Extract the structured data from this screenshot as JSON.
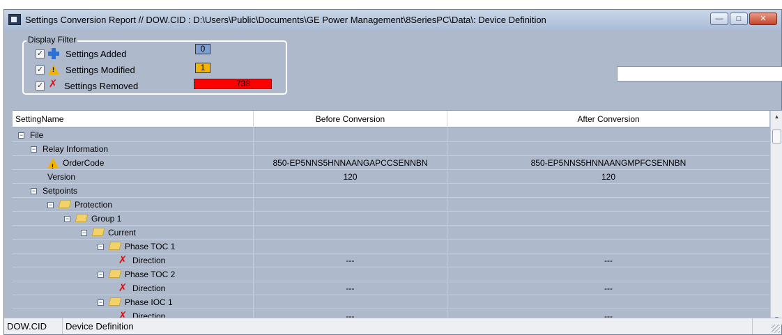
{
  "window": {
    "title": "Settings Conversion Report // DOW.CID : D:\\Users\\Public\\Documents\\GE Power Management\\8SeriesPC\\Data\\: Device Definition"
  },
  "filter": {
    "legend": "Display Filter",
    "added": {
      "label": "Settings Added",
      "count": "0",
      "checked": true,
      "color": "#7f9fd1"
    },
    "modified": {
      "label": "Settings Modified",
      "count": "1",
      "checked": true,
      "color": "#f5b400"
    },
    "removed": {
      "label": "Settings Removed",
      "count": "738",
      "checked": true,
      "color": "#ff0000"
    }
  },
  "search": {
    "value": ""
  },
  "grid": {
    "columns": [
      "SettingName",
      "Before Conversion",
      "After Conversion"
    ],
    "rows": [
      {
        "name": "File",
        "before": "",
        "after": "",
        "icon": "expander",
        "depth": 0
      },
      {
        "name": "Relay Information",
        "before": "",
        "after": "",
        "icon": "expander",
        "depth": 1
      },
      {
        "name": "OrderCode",
        "before": "850-EP5NNS5HNNAANGAPCCSENNBN",
        "after": "850-EP5NNS5HNNAANGMPFCSENNBN",
        "icon": "warning",
        "depth": 2
      },
      {
        "name": "Version",
        "before": "120",
        "after": "120",
        "icon": "none",
        "depth": 2
      },
      {
        "name": "Setpoints",
        "before": "",
        "after": "",
        "icon": "expander",
        "depth": 1
      },
      {
        "name": "Protection",
        "before": "",
        "after": "",
        "icon": "folder",
        "depth": 2
      },
      {
        "name": "Group 1",
        "before": "",
        "after": "",
        "icon": "folder",
        "depth": 3
      },
      {
        "name": "Current",
        "before": "",
        "after": "",
        "icon": "folder",
        "depth": 4
      },
      {
        "name": "Phase TOC 1",
        "before": "",
        "after": "",
        "icon": "folder",
        "depth": 5
      },
      {
        "name": "Direction",
        "before": "---",
        "after": "---",
        "icon": "removed",
        "depth": 6
      },
      {
        "name": "Phase TOC 2",
        "before": "",
        "after": "",
        "icon": "folder",
        "depth": 5
      },
      {
        "name": "Direction",
        "before": "---",
        "after": "---",
        "icon": "removed",
        "depth": 6
      },
      {
        "name": "Phase IOC 1",
        "before": "",
        "after": "",
        "icon": "folder",
        "depth": 5
      },
      {
        "name": "Direction",
        "before": "---",
        "after": "---",
        "icon": "removed",
        "depth": 6
      }
    ]
  },
  "status": {
    "file": "DOW.CID",
    "view": "Device Definition"
  }
}
